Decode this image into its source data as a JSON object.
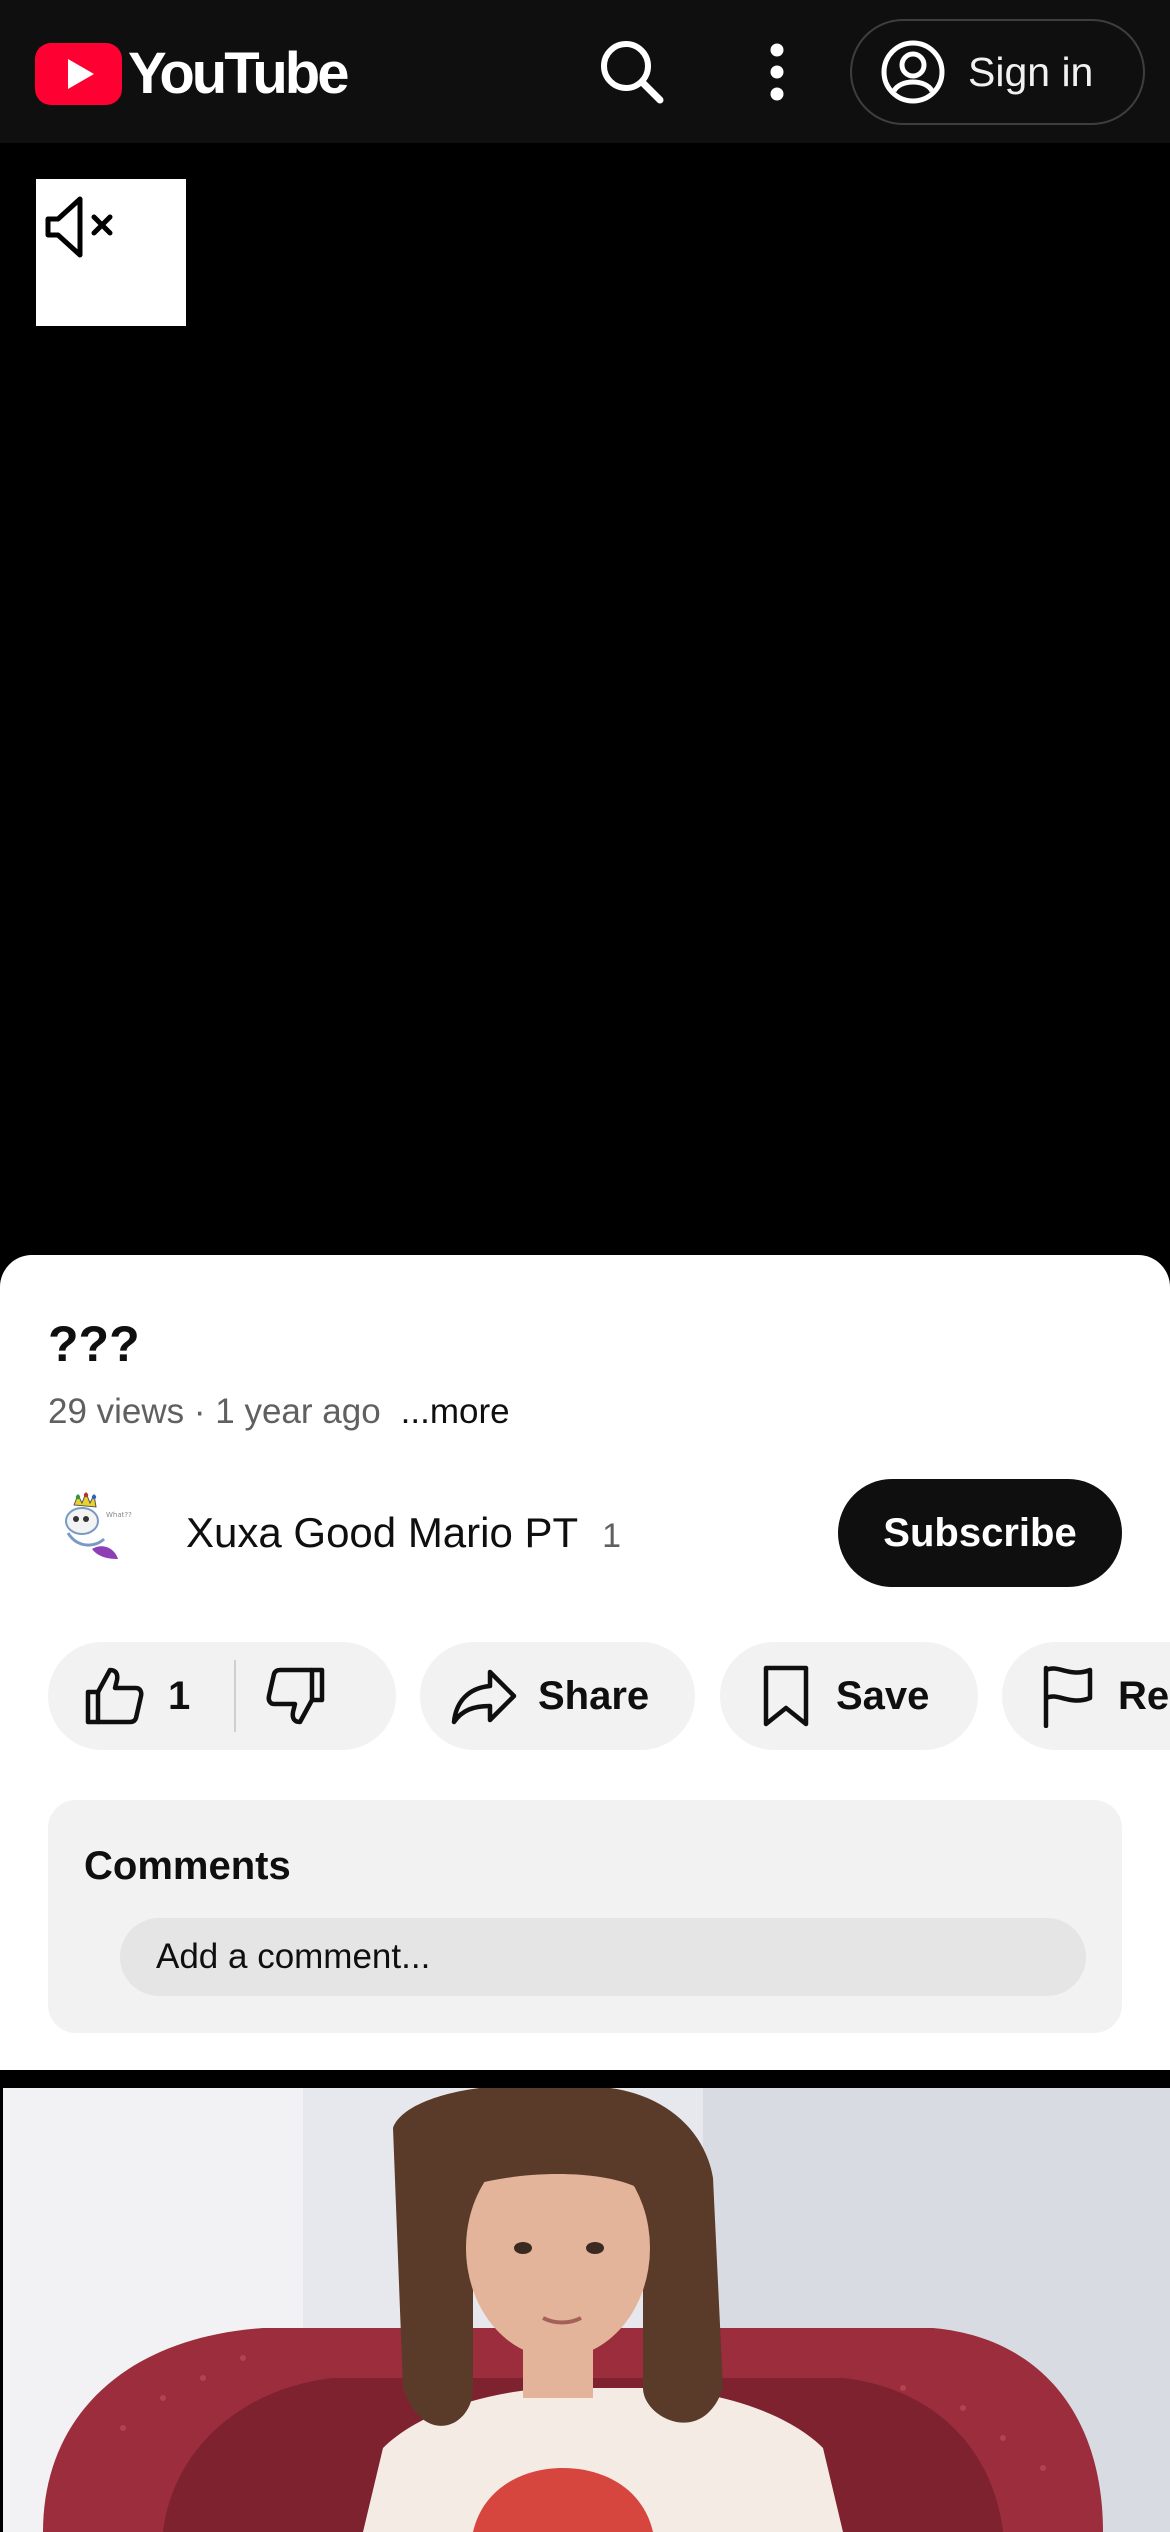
{
  "header": {
    "brand": "YouTube",
    "signin_label": "Sign in"
  },
  "video": {
    "muted": true
  },
  "details": {
    "title": "???",
    "meta": "29 views · 1 year ago",
    "more_label": "...more"
  },
  "channel": {
    "name": "Xuxa Good Mario PT",
    "subscribers": "1",
    "subscribe_label": "Subscribe"
  },
  "actions": {
    "like_count": "1",
    "share_label": "Share",
    "save_label": "Save",
    "report_label": "Re"
  },
  "comments": {
    "heading": "Comments",
    "placeholder": "Add a comment..."
  },
  "colors": {
    "brand_red": "#ff0033",
    "topbar_bg": "#0f0f0f",
    "pill_bg": "#f2f2f2"
  }
}
